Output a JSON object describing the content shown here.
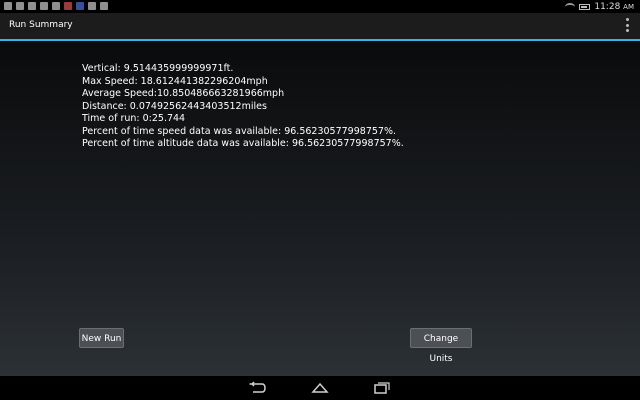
{
  "status_bar": {
    "time": "11:28",
    "time_suffix": "AM",
    "icons": [
      "notification-icon",
      "notification-icon",
      "mail-icon",
      "notification-icon",
      "download-icon",
      "app-icon",
      "app-icon",
      "app-icon",
      "camera-icon",
      "wifi-icon",
      "battery-icon"
    ]
  },
  "action_bar": {
    "title": "Run Summary",
    "menu_icon": "overflow-menu-icon"
  },
  "stats": {
    "vertical": "Vertical: 9.514435999999971ft.",
    "max_speed": "Max Speed: 18.612441382296204mph",
    "average_speed": "Average Speed:10.850486663281966mph",
    "distance": "Distance: 0.07492562443403512miles",
    "time_of_run": "Time of run: 0:25.744",
    "speed_availability": "Percent of time speed data was available: 96.56230577998757%.",
    "altitude_availability": "Percent of time altitude data was available: 96.56230577998757%."
  },
  "buttons": {
    "new_run": "New Run",
    "change_units": "Change Units"
  },
  "colors": {
    "accent": "#33b5e5",
    "button_bg": "#4c5055"
  }
}
